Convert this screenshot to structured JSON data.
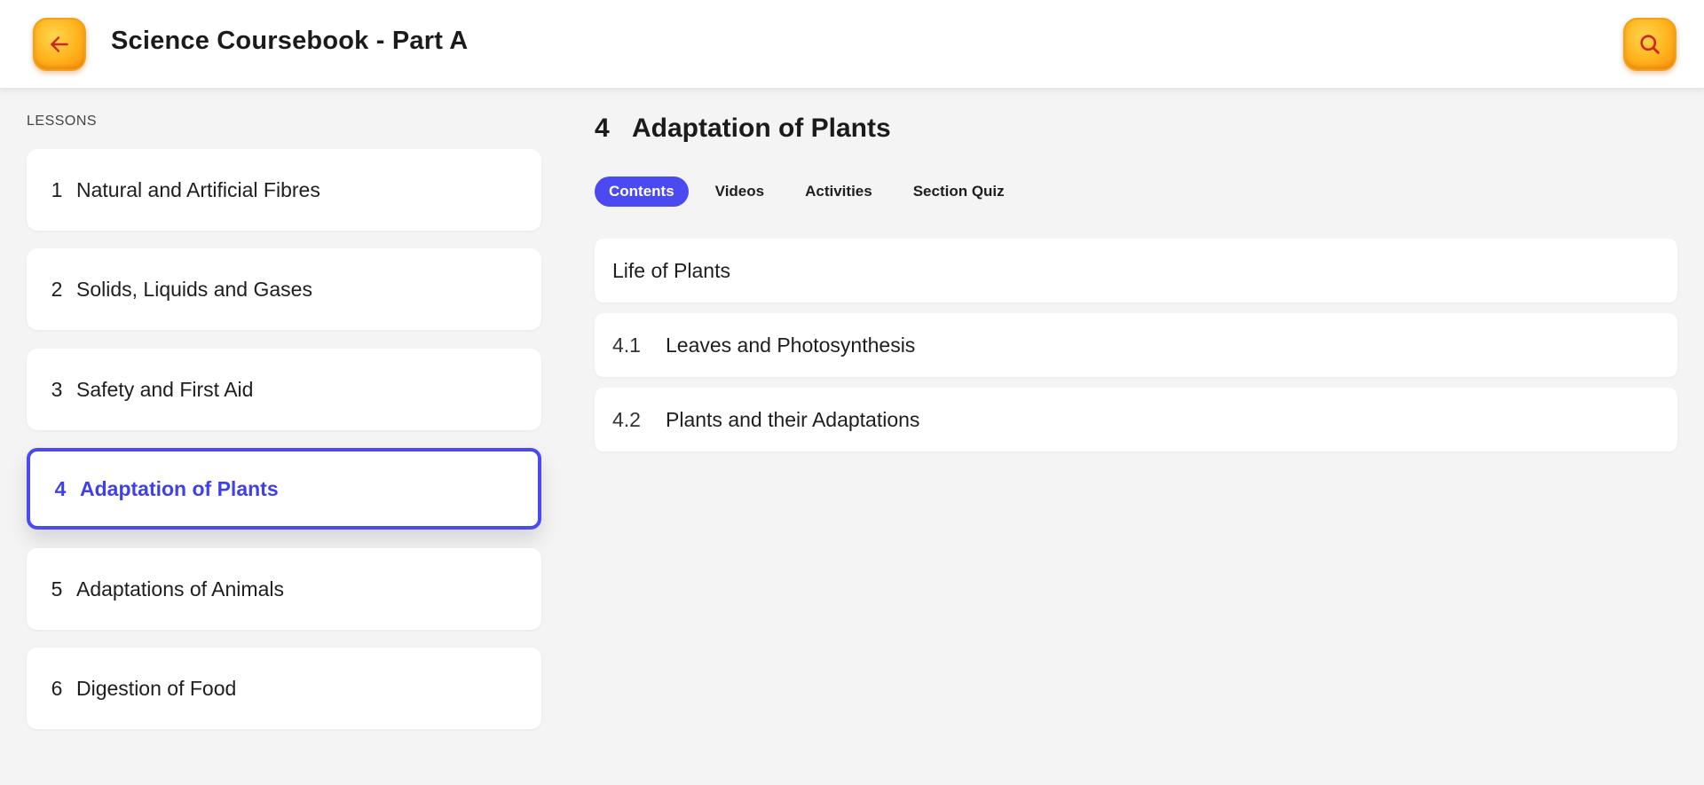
{
  "header": {
    "title": "Science Coursebook - Part A",
    "back_icon": "arrow-left-icon",
    "search_icon": "search-icon",
    "accent": "#ffb21c"
  },
  "sidebar": {
    "label": "LESSONS",
    "lessons": [
      {
        "num": "1",
        "title": "Natural and Artificial Fibres"
      },
      {
        "num": "2",
        "title": "Solids, Liquids and Gases"
      },
      {
        "num": "3",
        "title": "Safety and First Aid"
      },
      {
        "num": "4",
        "title": "Adaptation of Plants",
        "active": true
      },
      {
        "num": "5",
        "title": "Adaptations of Animals"
      },
      {
        "num": "6",
        "title": "Digestion of Food"
      }
    ]
  },
  "main": {
    "heading_num": "4",
    "heading_title": "Adaptation of Plants",
    "tabs": [
      {
        "label": "Contents",
        "active": true
      },
      {
        "label": "Videos"
      },
      {
        "label": "Activities"
      },
      {
        "label": "Section Quiz"
      }
    ],
    "contents": [
      {
        "num": "",
        "title": "Life of Plants"
      },
      {
        "num": "4.1",
        "title": "Leaves and Photosynthesis"
      },
      {
        "num": "4.2",
        "title": "Plants and their Adaptations"
      }
    ]
  },
  "colors": {
    "active": "#4a4af0",
    "background": "#f4f4f4"
  }
}
